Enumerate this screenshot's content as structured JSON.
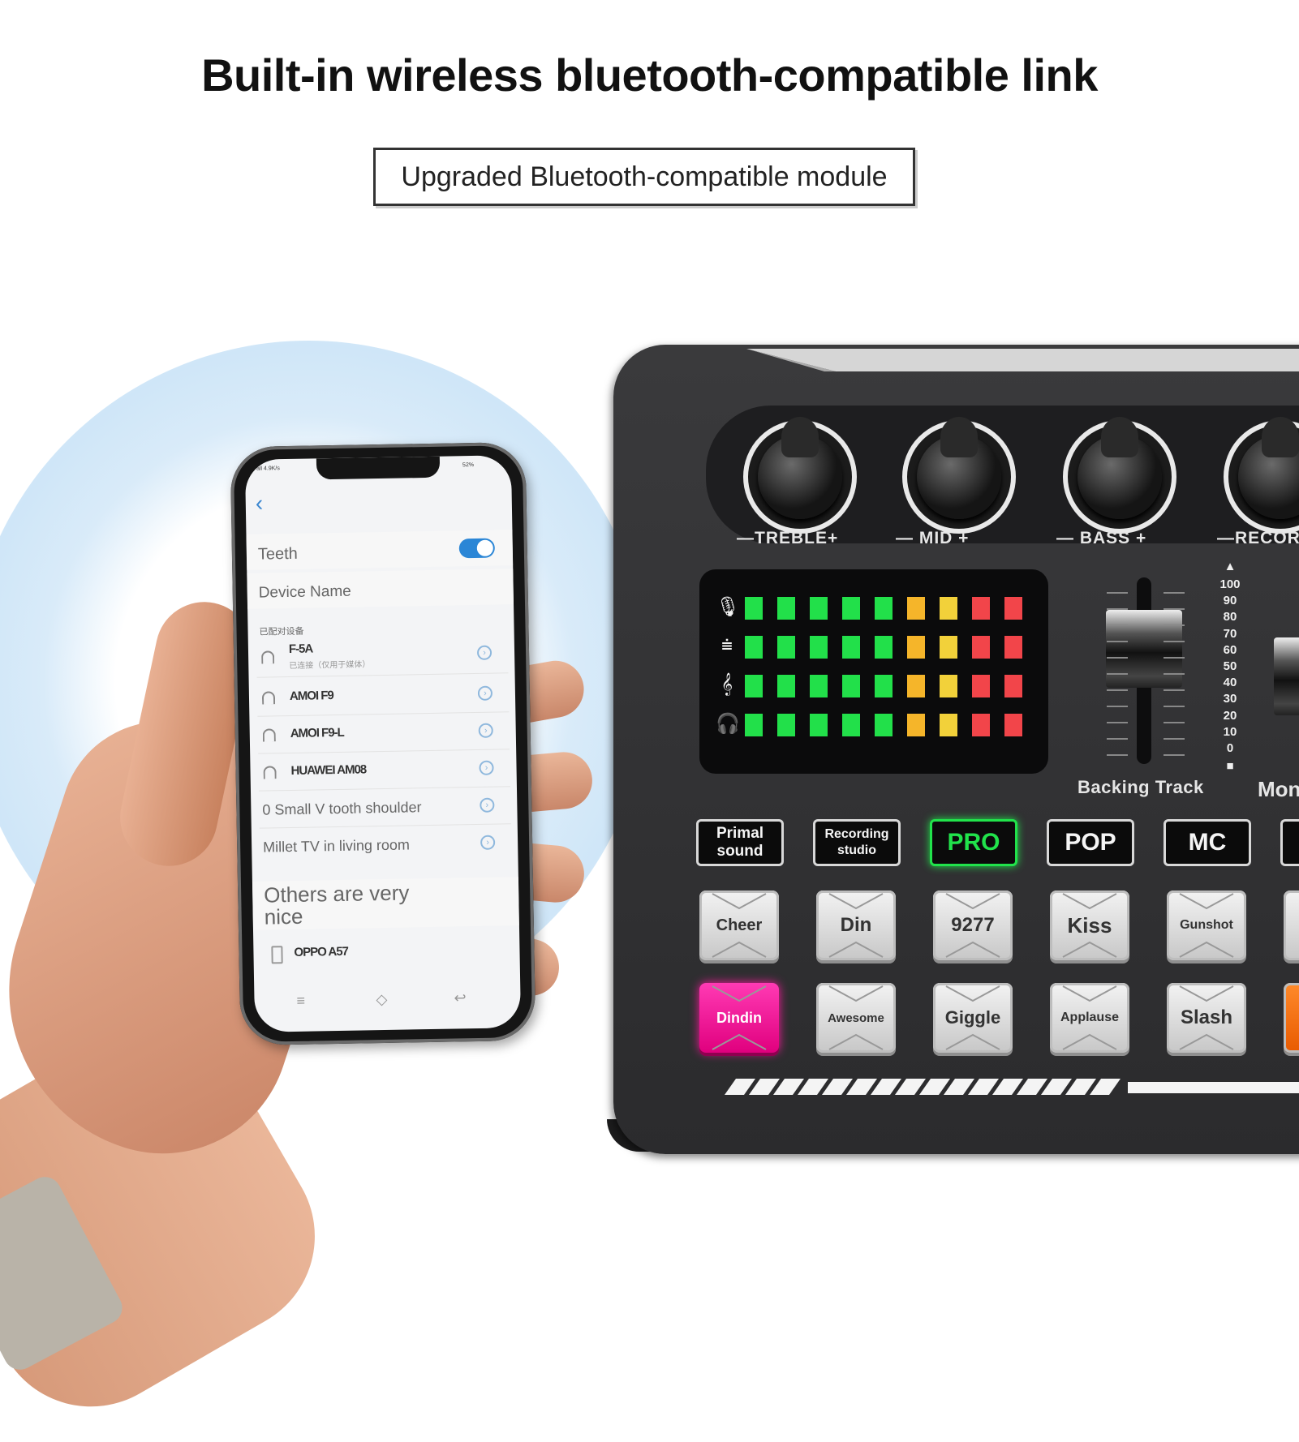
{
  "header": {
    "title": "Built-in wireless bluetooth-compatible link",
    "subtitle": "Upgraded Bluetooth-compatible module"
  },
  "phone": {
    "status_left": "all 4.9K/s",
    "status_right": "52%",
    "back_glyph": "‹",
    "bluetooth_label": "Teeth",
    "bluetooth_on": true,
    "device_name_label": "Device Name",
    "paired_header": "已配对设备",
    "paired_devices": [
      {
        "name": "F-5A",
        "sub": "已连接（仅用于媒体）",
        "icon": "headphones-icon"
      },
      {
        "name": "AMOI F9",
        "icon": "headphones-icon"
      },
      {
        "name": "AMOI F9-L",
        "icon": "headphones-icon"
      },
      {
        "name": "HUAWEI AM08",
        "icon": "headphones-icon"
      }
    ],
    "plain_devices": [
      "0 Small V tooth shoulder",
      "Millet TV in living room"
    ],
    "others_label": "Others are very nice",
    "other_device": "OPPO A57",
    "nav_icons": [
      "menu-icon",
      "home-icon",
      "back-icon"
    ],
    "nav_glyphs": [
      "≡",
      "◇",
      "↩"
    ],
    "info_glyph": "›"
  },
  "mixer": {
    "knobs": [
      {
        "label": "—TREBLE+"
      },
      {
        "label": "—  MID  +"
      },
      {
        "label": "—  BASS  +"
      },
      {
        "label": "—RECORD"
      }
    ],
    "meter_rows": [
      {
        "icon": "mic-icon",
        "glyph": "🎙"
      },
      {
        "icon": "equalizer-icon",
        "glyph": "⩧"
      },
      {
        "icon": "treble-clef-icon",
        "glyph": "𝄞"
      },
      {
        "icon": "headphones-icon",
        "glyph": "🎧"
      }
    ],
    "meter_colors": [
      "#22e04a",
      "#22e04a",
      "#22e04a",
      "#22e04a",
      "#22e04a",
      "#f5b52a",
      "#f2d13a",
      "#f2454a",
      "#f2454a"
    ],
    "fader_scale": [
      "100",
      "90",
      "80",
      "70",
      "60",
      "50",
      "40",
      "30",
      "20",
      "10",
      "0"
    ],
    "fader_top_glyph": "▲",
    "fader_bottom_glyph": "■",
    "fader_levels": {
      "backing_track": 0.7,
      "monitor": 0.45
    },
    "backing_track_label": "Backing Track",
    "monitor_label": "Mon",
    "mode_buttons": [
      {
        "label": "Primal sound",
        "active": false
      },
      {
        "label": "Recording studio",
        "active": false
      },
      {
        "label": "PRO",
        "active": true
      },
      {
        "label": "POP",
        "active": false
      },
      {
        "label": "MC",
        "active": false
      }
    ],
    "pads_row1": [
      "Cheer",
      "Din",
      "9277",
      "Kiss",
      "Gunshot"
    ],
    "pads_row2": [
      "Dindin",
      "Awesome",
      "Giggle",
      "Applause",
      "Slash"
    ],
    "colors": {
      "pro_green": "#21e34b",
      "dindin_pink": "#ff1aa0",
      "orange_pad": "#ff6a00",
      "bluetooth_blue": "#2b86d6"
    }
  }
}
